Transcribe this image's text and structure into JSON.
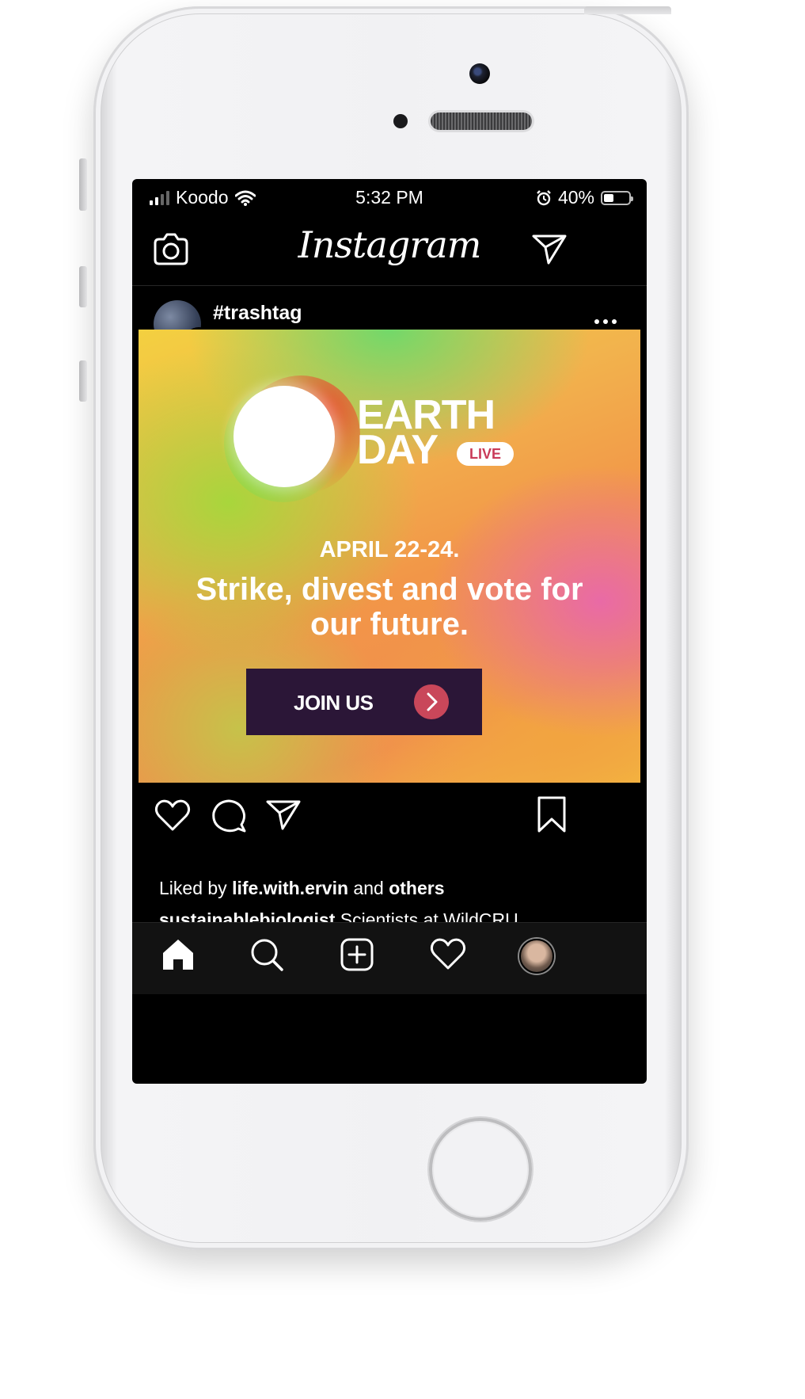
{
  "status_bar": {
    "carrier": "Koodo",
    "time": "5:32 PM",
    "battery": "40%",
    "battery_level": 0.4
  },
  "app": {
    "logo_text": "Instagram"
  },
  "post": {
    "title": "#trashtag",
    "account": "sustainablebiologist",
    "badge": "#",
    "image": {
      "brand_line1": "EARTH",
      "brand_line2": "DAY",
      "live_badge": "LIVE",
      "date": "APRIL 22-24.",
      "tagline": "Strike, divest and vote for our future.",
      "cta": "JOIN US",
      "colors": {
        "cta_background": "#2b1637",
        "cta_arrow": "#c9475a",
        "live_text": "#c93a58"
      }
    },
    "liked_prefix": "Liked by ",
    "liked_user": "life.with.ervin",
    "liked_middle": " and ",
    "liked_suffix": "others",
    "caption_user": "sustainablebiologist",
    "caption_text": " Scientists at WildCRU"
  },
  "icons": {
    "header": [
      "camera-icon",
      "direct-message-icon"
    ],
    "post": [
      "like-icon",
      "comment-icon",
      "share-icon",
      "bookmark-icon",
      "more-options-icon"
    ],
    "tabs": [
      "home-icon",
      "search-icon",
      "new-post-icon",
      "activity-icon",
      "profile-avatar"
    ]
  }
}
